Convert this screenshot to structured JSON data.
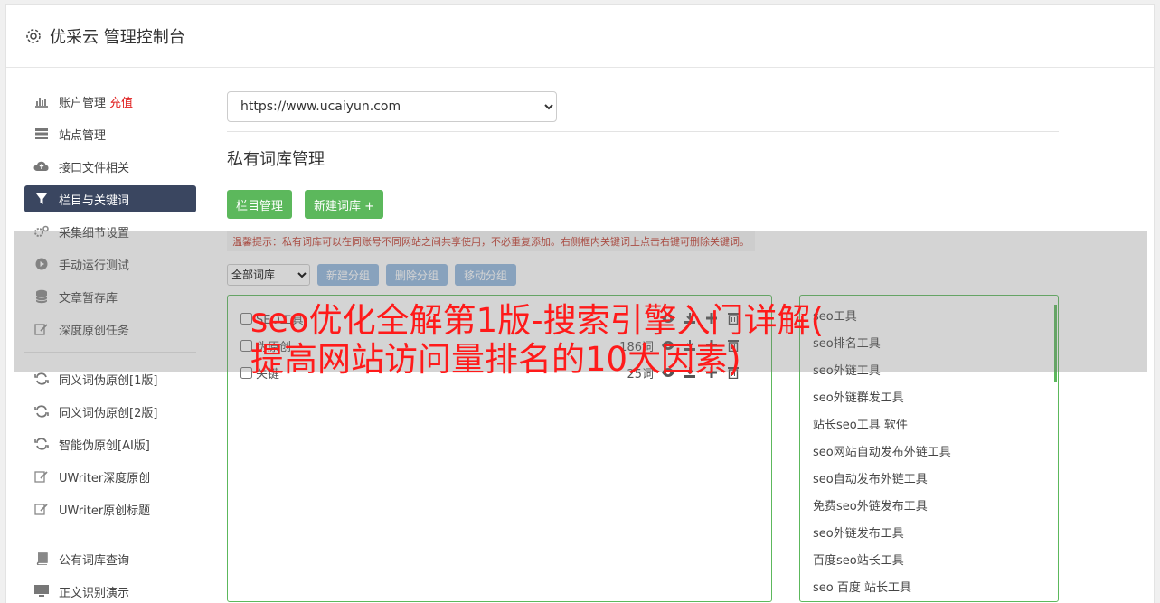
{
  "header": {
    "title": "优采云 管理控制台",
    "icon": "gear-icon"
  },
  "sidebar": {
    "groups": [
      [
        {
          "label": "账户管理",
          "badge": "充值",
          "icon": "bar-chart-icon"
        },
        {
          "label": "站点管理",
          "icon": "server-icon"
        },
        {
          "label": "接口文件相关",
          "icon": "cloud-upload-icon"
        },
        {
          "label": "栏目与关键词",
          "icon": "filter-icon",
          "active": true
        },
        {
          "label": "采集细节设置",
          "icon": "gears-icon"
        },
        {
          "label": "手动运行测试",
          "icon": "play-icon"
        },
        {
          "label": "文章暂存库",
          "icon": "database-icon"
        },
        {
          "label": "深度原创任务",
          "icon": "edit-icon"
        }
      ],
      [
        {
          "label": "同义词伪原创[1版]",
          "icon": "refresh-icon"
        },
        {
          "label": "同义词伪原创[2版]",
          "icon": "refresh-icon"
        },
        {
          "label": "智能伪原创[AI版]",
          "icon": "refresh-icon"
        },
        {
          "label": "UWriter深度原创",
          "icon": "edit-icon"
        },
        {
          "label": "UWriter原创标题",
          "icon": "edit-icon"
        }
      ],
      [
        {
          "label": "公有词库查询",
          "icon": "book-icon"
        },
        {
          "label": "正文识别演示",
          "icon": "monitor-icon"
        }
      ]
    ]
  },
  "main": {
    "site_url": "https://www.ucaiyun.com",
    "section_title": "私有词库管理",
    "btn_column": "栏目管理",
    "btn_new_lib": "新建词库 +",
    "hint": "温馨提示：私有词库可以在同账号不同网站之间共享使用，不必重复添加。右侧框内关键词上点击右键可删除关键词。",
    "lib_filter": "全部词库",
    "btn_new_group": "新建分组",
    "btn_del_group": "删除分组",
    "btn_move_group": "移动分组",
    "libraries": [
      {
        "name": "SEO工具",
        "count": ""
      },
      {
        "name": "伪原创",
        "count": "186词"
      },
      {
        "name": "关键",
        "count": "25词"
      }
    ],
    "keywords": [
      "seo工具",
      "seo排名工具",
      "seo外链工具",
      "seo外链群发工具",
      "站长seo工具 软件",
      "seo网站自动发布外链工具",
      "seo自动发布外链工具",
      "免费seo外链发布工具",
      "seo外链发布工具",
      "百度seo站长工具",
      "seo 百度 站长工具"
    ]
  },
  "overlay": {
    "line1": "seo优化全解第1版-搜索引擎入门详解(",
    "line2": "提高网站访问量排名的10大因素)",
    "color": "#ff1a1a"
  }
}
